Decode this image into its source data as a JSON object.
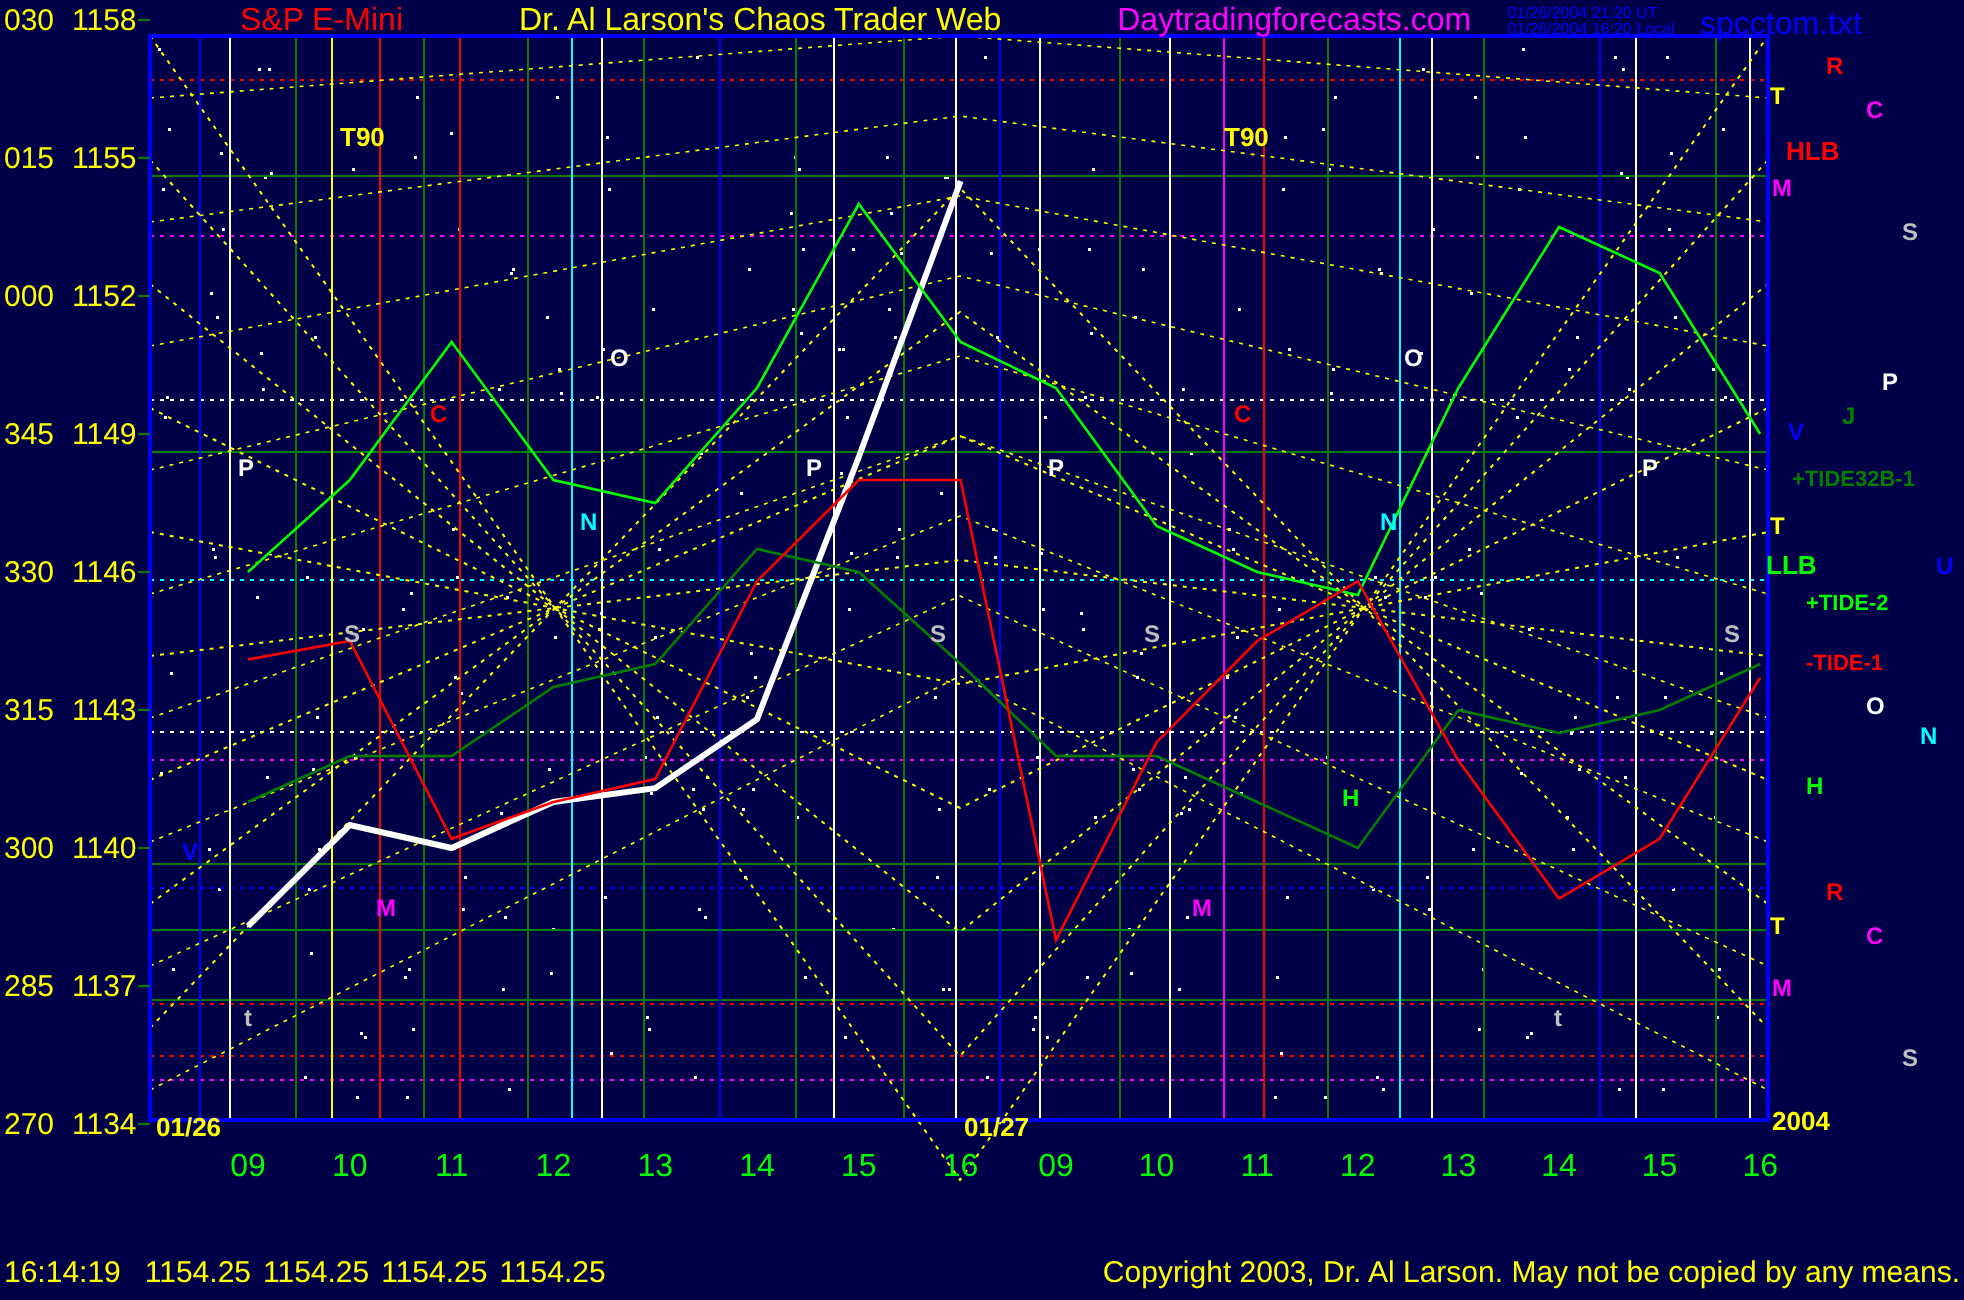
{
  "header": {
    "site_title": "Dr. Al Larson's Chaos Trader Web",
    "website": "Daytradingforecasts.com",
    "timestamp_ut": "01/26/2004 21:20 UT",
    "timestamp_local": "01/26/2004 16:20 Local",
    "file_name": "spcctom.txt"
  },
  "chart": {
    "angle_labels": [
      "030",
      "015",
      "000",
      "345",
      "330",
      "315",
      "300",
      "285",
      "270"
    ],
    "chart_data": {
      "type": "line",
      "grid": true,
      "categories": [
        "09",
        "10",
        "11",
        "12",
        "13",
        "14",
        "15",
        "16",
        "09",
        "10",
        "11",
        "12",
        "13",
        "14",
        "15",
        "16"
      ],
      "ylim": [
        1134,
        1158
      ],
      "yticks": [
        1158,
        1155,
        1152,
        1149,
        1146,
        1143,
        1140,
        1137,
        1134
      ],
      "series": [
        {
          "name": "S&P E-Mini",
          "color": "#ffffff",
          "values": [
            1138.3,
            1140.5,
            1140,
            1141,
            1141.3,
            1142.8,
            1148.5,
            1154.5,
            null,
            null,
            null,
            null,
            null,
            null,
            null,
            null
          ]
        },
        {
          "name": "+TIDE32B-1",
          "color": "#008000",
          "values": [
            1141,
            1142,
            1142,
            1143.5,
            1144,
            1146.5,
            1146,
            1144,
            1142,
            1142,
            1141,
            1140,
            1143,
            1142.5,
            1143,
            1144
          ]
        },
        {
          "name": "+TIDE-2",
          "color": "#00ff00",
          "values": [
            1146,
            1148,
            1151,
            1148,
            1147.5,
            1150,
            1154,
            1151,
            1150,
            1147,
            1146,
            1145.5,
            1150,
            1153.5,
            1152.5,
            1149
          ]
        },
        {
          "name": "-TIDE-1",
          "color": "#ff0000",
          "values": [
            1144.1,
            1144.5,
            1140.2,
            1141,
            1141.5,
            1145.8,
            1148,
            1148,
            1138,
            1142.3,
            1144.5,
            1145.8,
            1141.9,
            1138.9,
            1140.2,
            1143.7
          ]
        }
      ]
    },
    "markers": [
      {
        "text": "01/26",
        "color": "#ffff00"
      },
      {
        "text": "01/27",
        "color": "#ffff00"
      },
      {
        "text": "T90",
        "color": "#ffff00"
      },
      {
        "text": "T90",
        "color": "#ffff00"
      },
      {
        "text": "P",
        "color": "#ffffff"
      },
      {
        "text": "C",
        "color": "#ff0000"
      },
      {
        "text": "O",
        "color": "#ffffff"
      },
      {
        "text": "N",
        "color": "#00ffff"
      },
      {
        "text": "S",
        "color": "#c0c0c0"
      },
      {
        "text": "P",
        "color": "#ffffff"
      },
      {
        "text": "S",
        "color": "#c0c0c0"
      },
      {
        "text": "P",
        "color": "#ffffff"
      },
      {
        "text": "S",
        "color": "#c0c0c0"
      },
      {
        "text": "C",
        "color": "#ff0000"
      },
      {
        "text": "N",
        "color": "#00ffff"
      },
      {
        "text": "O",
        "color": "#ffffff"
      },
      {
        "text": "H",
        "color": "#00ff00"
      },
      {
        "text": "P",
        "color": "#ffffff"
      },
      {
        "text": "S",
        "color": "#c0c0c0"
      },
      {
        "text": "V",
        "color": "#0000ff"
      },
      {
        "text": "M",
        "color": "#ff00ff"
      },
      {
        "text": "M",
        "color": "#ff00ff"
      },
      {
        "text": "t",
        "color": "#c0c0c0"
      },
      {
        "text": "t",
        "color": "#c0c0c0"
      },
      {
        "text": "T",
        "color": "#ffff00"
      },
      {
        "text": "R",
        "color": "#ff0000"
      },
      {
        "text": "C",
        "color": "#ff00ff"
      },
      {
        "text": "HLB",
        "color": "#ff0000"
      },
      {
        "text": "M",
        "color": "#ff00ff"
      },
      {
        "text": "S",
        "color": "#c0c0c0"
      },
      {
        "text": "P",
        "color": "#ffffff"
      },
      {
        "text": "J",
        "color": "#008000"
      },
      {
        "text": "V",
        "color": "#0000ff"
      },
      {
        "text": "T",
        "color": "#ffff00"
      },
      {
        "text": "LLB",
        "color": "#00ff00"
      },
      {
        "text": "U",
        "color": "#0000ff"
      },
      {
        "text": "O",
        "color": "#ffffff"
      },
      {
        "text": "N",
        "color": "#00ffff"
      },
      {
        "text": "H",
        "color": "#00ff00"
      },
      {
        "text": "R",
        "color": "#ff0000"
      },
      {
        "text": "T",
        "color": "#ffff00"
      },
      {
        "text": "C",
        "color": "#ff00ff"
      },
      {
        "text": "M",
        "color": "#ff00ff"
      },
      {
        "text": "S",
        "color": "#c0c0c0"
      },
      {
        "text": "2004",
        "color": "#ffff00"
      }
    ]
  },
  "footer": {
    "time": "16:14:19",
    "prices": [
      "1154.25",
      "1154.25",
      "1154.25",
      "1154.25"
    ],
    "copyright": "Copyright 2003, Dr. Al Larson. May not be copied by any means."
  }
}
